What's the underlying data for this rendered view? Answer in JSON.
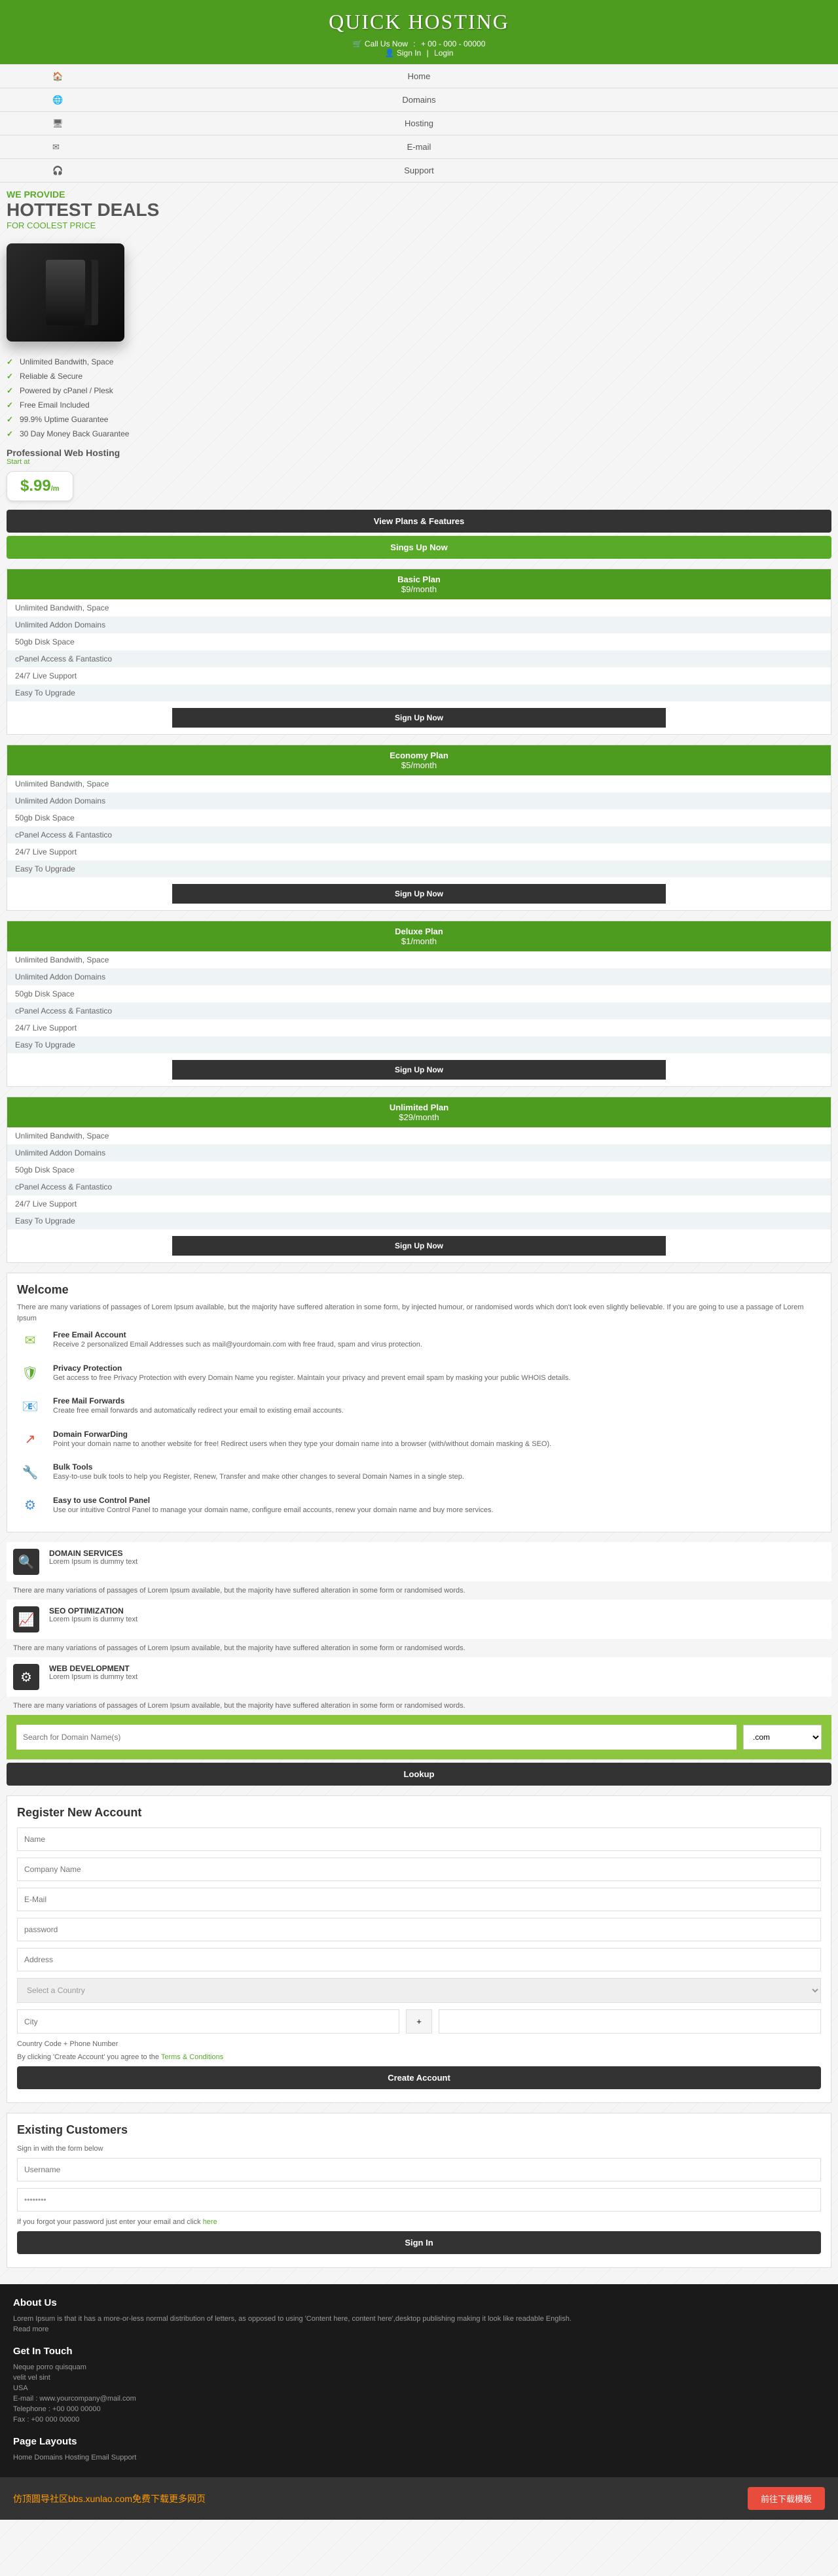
{
  "header": {
    "title": "QUICK HOSTING",
    "call_label": "Call Us Now",
    "phone": "+ 00 - 000 - 00000",
    "signin": "Sign In",
    "login": "Login"
  },
  "nav": [
    {
      "icon": "🏠",
      "label": "Home"
    },
    {
      "icon": "🌐",
      "label": "Domains"
    },
    {
      "icon": "🖥",
      "label": "Hosting"
    },
    {
      "icon": "✉",
      "label": "E-mail"
    },
    {
      "icon": "🎧",
      "label": "Support"
    }
  ],
  "hero": {
    "provide": "WE PROVIDE",
    "title": "HOTTEST DEALS",
    "subtitle": "FOR COOLEST PRICE",
    "bullets": [
      "Unlimited Bandwith, Space",
      "Reliable & Secure",
      "Powered by cPanel / Plesk",
      "Free Email Included",
      "99.9% Uptime Guarantee",
      "30 Day Money Back Guarantee"
    ],
    "pro_title": "Professional Web Hosting",
    "start_at": "Start at",
    "price": "$.99",
    "price_unit": "/m",
    "btn_plans": "View Plans & Features",
    "btn_signup": "Sings Up Now"
  },
  "plans": [
    {
      "name": "Basic Plan",
      "price": "$9/month",
      "features": [
        "Unlimited Bandwith, Space",
        "Unlimited Addon Domains",
        "50gb Disk Space",
        "cPanel Access & Fantastico",
        "24/7 Live Support",
        "Easy To Upgrade"
      ],
      "btn": "Sign Up Now"
    },
    {
      "name": "Economy Plan",
      "price": "$5/month",
      "features": [
        "Unlimited Bandwith, Space",
        "Unlimited Addon Domains",
        "50gb Disk Space",
        "cPanel Access & Fantastico",
        "24/7 Live Support",
        "Easy To Upgrade"
      ],
      "btn": "Sign Up Now"
    },
    {
      "name": "Deluxe Plan",
      "price": "$1/month",
      "features": [
        "Unlimited Bandwith, Space",
        "Unlimited Addon Domains",
        "50gb Disk Space",
        "cPanel Access & Fantastico",
        "24/7 Live Support",
        "Easy To Upgrade"
      ],
      "btn": "Sign Up Now"
    },
    {
      "name": "Unlimited Plan",
      "price": "$29/month",
      "features": [
        "Unlimited Bandwith, Space",
        "Unlimited Addon Domains",
        "50gb Disk Space",
        "cPanel Access & Fantastico",
        "24/7 Live Support",
        "Easy To Upgrade"
      ],
      "btn": "Sign Up Now"
    }
  ],
  "welcome": {
    "title": "Welcome",
    "text": "There are many variations of passages of Lorem Ipsum available, but the majority have suffered alteration in some form, by injected humour, or randomised words which don't look even slightly believable. If you are going to use a passage of Lorem Ipsum",
    "features": [
      {
        "icon": "✉",
        "color": "#8cc63f",
        "title": "Free Email Account",
        "desc": "Receive 2 personalized Email Addresses such as mail@yourdomain.com with free fraud, spam and virus protection."
      },
      {
        "icon": "🛡",
        "color": "#5aaa2a",
        "title": "Privacy Protection",
        "desc": "Get access to free Privacy Protection with every Domain Name you register. Maintain your privacy and prevent email spam by masking your public WHOIS details."
      },
      {
        "icon": "📧",
        "color": "#4a90d9",
        "title": "Free Mail Forwards",
        "desc": "Create free email forwards and automatically redirect your email to existing email accounts."
      },
      {
        "icon": "↗",
        "color": "#e74c3c",
        "title": "Domain ForwarDing",
        "desc": "Point your domain name to another website for free! Redirect users when they type your domain name into a browser (with/without domain masking & SEO)."
      },
      {
        "icon": "🔧",
        "color": "#666",
        "title": "Bulk Tools",
        "desc": "Easy-to-use bulk tools to help you Register, Renew, Transfer and make other changes to several Domain Names in a single step."
      },
      {
        "icon": "⚙",
        "color": "#4a90d9",
        "title": "Easy to use Control Panel",
        "desc": "Use our intuitive Control Panel to manage your domain name, configure email accounts, renew your domain name and buy more services."
      }
    ]
  },
  "services": [
    {
      "icon": "🔍",
      "title": "DOMAIN SERVICES",
      "sub": "Lorem Ipsum is dummy text",
      "desc": "There are many variations of passages of Lorem Ipsum available, but the majority have suffered alteration in some form or randomised words."
    },
    {
      "icon": "📈",
      "title": "SEO OPTIMIZATION",
      "sub": "Lorem Ipsum is dummy text",
      "desc": "There are many variations of passages of Lorem Ipsum available, but the majority have suffered alteration in some form or randomised words."
    },
    {
      "icon": "⚙",
      "title": "WEB DEVELOPMENT",
      "sub": "Lorem Ipsum is dummy text",
      "desc": "There are many variations of passages of Lorem Ipsum available, but the majority have suffered alteration in some form or randomised words."
    }
  ],
  "search": {
    "placeholder": "Search for Domain Name(s)",
    "tld": ".com",
    "btn": "Lookup"
  },
  "register": {
    "title": "Register New Account",
    "name_ph": "Name",
    "company_ph": "Company Name",
    "email_ph": "E-Mail",
    "password_ph": "password",
    "address_ph": "Address",
    "country_ph": "Select a Country",
    "city_ph": "City",
    "cc_note": "Country Code + Phone Number",
    "terms_pre": "By clicking 'Create Account' you agree to the ",
    "terms_link": "Terms & Conditions",
    "btn": "Create Account"
  },
  "existing": {
    "title": "Existing Customers",
    "sub": "Sign in with the form below",
    "user_ph": "Username",
    "pass_val": "••••••••",
    "forgot_pre": "If you forgot your password just enter your email and click ",
    "forgot_link": "here",
    "btn": "Sign In"
  },
  "about": {
    "title": "About Us",
    "text": "Lorem Ipsum is that it has a more-or-less normal distribution of letters, as opposed to using 'Content here, content here',desktop publishing making it look like readable English.",
    "read_more": "Read more",
    "touch_title": "Get In Touch",
    "touch_sub": "Neque porro quisquam",
    "lines": [
      "velit vel sint",
      "USA",
      "E-mail : www.yourcompany@mail.com",
      "Telephone : +00 000 00000",
      "Fax : +00 000 00000"
    ],
    "layouts_title": "Page Layouts",
    "layouts": "Home  Domains  Hosting  Email  Support"
  },
  "footer": {
    "text": "仿顶圆导社区bbs.xunlao.com免费下载更多网页",
    "btn": "前往下载模板"
  }
}
